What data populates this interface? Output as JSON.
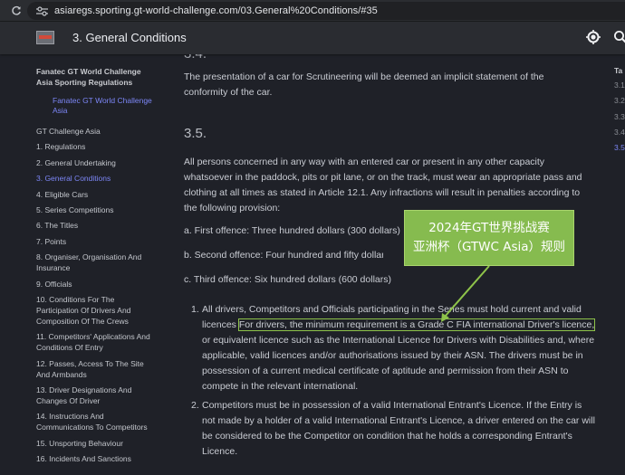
{
  "browser": {
    "url": "asiaregs.sporting.gt-world-challenge.com/03.General%20Conditions/#35"
  },
  "header": {
    "title": "3. General Conditions"
  },
  "sidebar": {
    "group_title": "Fanatec GT World Challenge Asia Sporting Regulations",
    "sub_link": "Fanatec GT World Challenge Asia",
    "items": [
      "GT Challenge Asia",
      "1. Regulations",
      "2. General Undertaking",
      "3. General Conditions",
      "4. Eligible Cars",
      "5. Series Competitions",
      "6. The Titles",
      "7. Points",
      "8. Organiser, Organisation And Insurance",
      "9. Officials",
      "10. Conditions For The Participation Of Drivers And Composition Of The Crews",
      "11. Competitors' Applications And Conditions Of Entry",
      "12. Passes, Access To The Site And Armbands",
      "13. Driver Designations And Changes Of Driver",
      "14. Instructions And Communications To Competitors",
      "15. Unsporting Behaviour",
      "16. Incidents And Sanctions"
    ]
  },
  "toc": {
    "title": "Ta",
    "items": [
      "3.1",
      "3.2",
      "3.3",
      "3.4",
      "3.5"
    ]
  },
  "content": {
    "prev_heading": "3.4.",
    "p1": "The presentation of a car for Scrutineering will be deemed an implicit statement of the conformity of the car.",
    "heading_35": "3.5.",
    "p2": "All persons concerned in any way with an entered car or present in any other capacity whatsoever in the paddock, pits or pit lane, or on the track, must wear an appropriate pass and clothing at all times as stated in Article 12.1. Any infractions will result in penalties according to the following provision:",
    "offence_a": "a. First offence: Three hundred dollars (300 dollars)",
    "offence_b": "b. Second offence: Four hundred and fifty dollars (450 dollars)",
    "offence_c": "c. Third offence: Six hundred dollars (600 dollars)",
    "list": [
      {
        "num": "1.",
        "pre": "All drivers, Competitors and Officials participating in the Series must hold current and valid licences",
        "highlight": "For drivers, the minimum requirement is a Grade C FIA international Driver's licence,",
        "post": "or equivalent licence such as the International Licence for Drivers with Disabilities and, where applicable, valid licences and/or authorisations issued by their ASN. The drivers must be in possession of a current medical certificate of aptitude and permission from their ASN to compete in the relevant international."
      },
      {
        "num": "2.",
        "text": "Competitors must be in possession of a valid International Entrant's Licence. If the Entry is not made by a holder of a valid International Entrant's Licence, a driver entered on the car will be considered to be the Competitor on condition that he holds a corresponding Entrant's Licence."
      }
    ]
  },
  "annotation": {
    "line1": "2024年GT世界挑战赛",
    "line2": "亚洲杯（GTWC Asia）规则",
    "color": "#86bb4f"
  },
  "icons": {
    "reload": "reload-icon",
    "tune": "site-settings-icon",
    "theme": "brightness-icon",
    "search": "search-icon"
  }
}
